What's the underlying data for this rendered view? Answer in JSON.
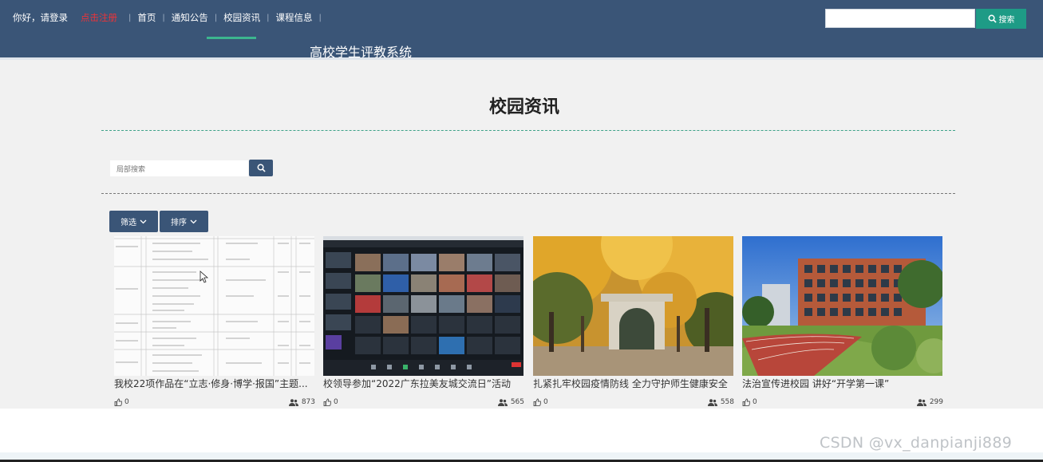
{
  "nav": {
    "greeting": "你好，请登录",
    "register": "点击注册",
    "items": [
      "首页",
      "通知公告",
      "校园资讯",
      "课程信息"
    ]
  },
  "site_title": "高校学生评教系统",
  "search": {
    "button": "搜索",
    "placeholder": ""
  },
  "page_title": "校园资讯",
  "local_search": {
    "placeholder": "局部搜索"
  },
  "filters": {
    "filter": "筛选",
    "sort": "排序"
  },
  "cards": [
    {
      "title": "我校22项作品在“立志·修身·博学·报国”主题...",
      "likes": "0",
      "views": "873"
    },
    {
      "title": "校领导参加“2022广东拉美友城交流日”活动",
      "likes": "0",
      "views": "565"
    },
    {
      "title": "扎紧扎牢校园疫情防线 全力守护师生健康安全",
      "likes": "0",
      "views": "558"
    },
    {
      "title": "法治宣传进校园 讲好“开学第一课”",
      "likes": "0",
      "views": "299"
    }
  ],
  "watermark": "CSDN @vx_danpianji889",
  "colors": {
    "header": "#3a5577",
    "accent": "#1e9b86",
    "register": "#e8343a"
  }
}
